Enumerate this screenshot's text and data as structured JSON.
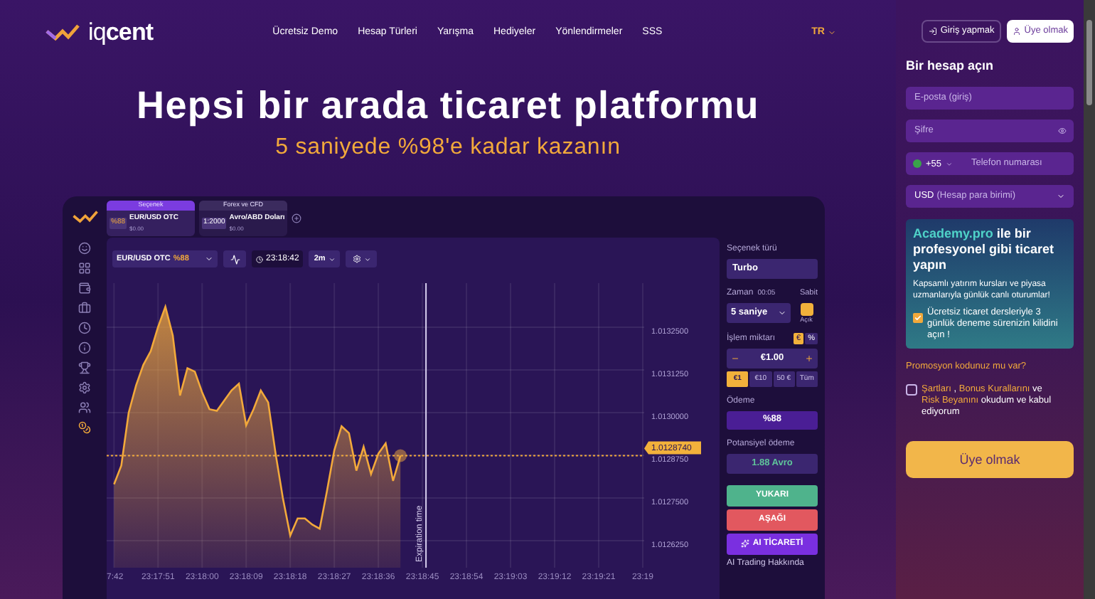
{
  "logo": "iq**cent**",
  "nav": {
    "links": [
      "Ücretsiz Demo",
      "Hesap Türleri",
      "Yarışma",
      "Hediyeler",
      "Yönlendirmeler",
      "SSS"
    ],
    "language": "TR"
  },
  "hero": {
    "title": "Hepsi bir arada ticaret platformu",
    "subtitle": "5 saniyede %98'e kadar kazanın"
  },
  "platform": {
    "sidebar_icons": [
      {
        "selected": false
      },
      {
        "selected": false
      },
      {
        "selected": false
      },
      {
        "selected": false
      },
      {
        "selected": false
      },
      {
        "selected": false
      },
      {
        "selected": false
      },
      {
        "selected": false
      },
      {
        "selected": false
      },
      {
        "selected": true
      }
    ],
    "tabs": [
      {
        "header": "Seçenek",
        "badge": "%88",
        "name": "EUR/USD OTC",
        "balance": "$0.00",
        "selected": true
      },
      {
        "header": "Forex ve CFD",
        "badge": "1:2000",
        "name": "Avro/ABD Doları",
        "balance": "$0.00",
        "selected": false
      }
    ],
    "toolbar": {
      "asset": "EUR/USD OTC",
      "payout": "%88",
      "time": "23:18:42",
      "interval": "2m"
    },
    "chart_data": {
      "type": "area",
      "categories": [
        "7:42",
        null,
        null,
        null,
        null,
        null,
        "23:17:51",
        null,
        null,
        null,
        null,
        null,
        "23:18:00",
        null,
        null,
        null,
        null,
        null,
        "23:18:09",
        null,
        null,
        null,
        null,
        null,
        "23:18:18",
        null,
        null,
        null,
        null,
        null,
        "23:18:27",
        null,
        null,
        null,
        null,
        null,
        "23:18:36",
        null,
        null,
        null,
        null,
        null,
        "23:18:45",
        null,
        null,
        null,
        null,
        null,
        "23:18:54",
        null,
        null,
        null,
        null,
        null,
        "23:19:03",
        null,
        null,
        null,
        null,
        null,
        "23:19:12",
        null,
        null,
        null,
        null,
        null,
        "23:19:21",
        null,
        null,
        null,
        null,
        null,
        "23:19"
      ],
      "series": [
        {
          "color": "#f2a93b",
          "values": [
            1.01279,
            1.012845,
            1.013,
            1.01308,
            1.01314,
            1.01318,
            1.01325,
            1.01331,
            1.013226,
            1.01305,
            1.01313,
            1.01312,
            1.01306,
            1.01301,
            1.013005,
            1.013035,
            1.013065,
            1.013085,
            1.012963,
            1.01301,
            1.013065,
            1.01303,
            1.01288,
            1.01275,
            1.01264,
            1.01269,
            1.01269,
            1.012672,
            1.01266,
            1.01277,
            1.01289,
            1.01296,
            1.01294,
            1.01283,
            1.0129,
            1.01282,
            1.01288,
            1.01291,
            1.0128,
            1.012874,
            null,
            null,
            null,
            null,
            null,
            null,
            null,
            null,
            null,
            null,
            null,
            null,
            null,
            null,
            null,
            null,
            null,
            null,
            null,
            null,
            null,
            null,
            null,
            null,
            null,
            null,
            null,
            null,
            null,
            null,
            null,
            null,
            null
          ]
        }
      ],
      "ylim": [
        1.012546,
        1.013379
      ],
      "grid": true,
      "ref_lines": [
        {
          "axis": "y",
          "value": 1.012874,
          "label": "1.0128740"
        }
      ],
      "yticks": [
        {
          "value": 1.01325,
          "label": "1.0132500"
        },
        {
          "value": 1.013125,
          "label": "1.0131250"
        },
        {
          "value": 1.013,
          "label": "1.0130000"
        },
        {
          "value": 1.012875,
          "label": "1.0128750"
        },
        {
          "value": 1.01275,
          "label": "1.0127500"
        },
        {
          "value": 1.012625,
          "label": "1.0126250"
        }
      ]
    },
    "expiration_label": "Expiration time",
    "trade": {
      "option_label": "Seçenek türü",
      "option": "Turbo",
      "time_label": "Zaman",
      "countdown": "00:05",
      "fixed_label": "Sabit",
      "duration": "5 saniye",
      "fixed_on": true,
      "fixed_state": "Açık",
      "amount_label": "İşlem miktarı",
      "units": [
        {
          "label": "€",
          "selected": true
        },
        {
          "label": "%",
          "selected": false
        }
      ],
      "amount": "€1.00",
      "quick": [
        {
          "label": "€1",
          "selected": true
        },
        {
          "label": "€10",
          "selected": false
        },
        {
          "label": "50 €",
          "selected": false
        },
        {
          "label": "Tüm",
          "selected": false
        }
      ],
      "payout_label": "Ödeme",
      "payout": "%88",
      "potential_label": "Potansiyel ödeme",
      "potential": "1.88 Avro",
      "up": "YUKARI",
      "down": "AŞAĞI",
      "ai": "AI TİCARETİ",
      "ai_info": "AI Trading Hakkında"
    }
  },
  "signup": {
    "login": "Giriş yapmak",
    "register": "Üye olmak",
    "heading": "Bir hesap açın",
    "email": {
      "placeholder": "E-posta (giriş)"
    },
    "password": {
      "placeholder": "Şifre"
    },
    "phone": {
      "code": "+55",
      "placeholder": "Telefon numarası"
    },
    "currency": {
      "value": "USD",
      "hint": "(Hesap para birimi)"
    },
    "academy": {
      "brand": "Academy.pro",
      "heading": "ile bir profesyonel gibi ticaret yapın",
      "text": "Kapsamlı yatırım kursları ve piyasa uzmanlarıyla günlük canlı oturumlar!",
      "checked": true,
      "offer": "Ücretsiz ticaret dersleriyle 3 günlük deneme sürenizin kilidini açın !"
    },
    "promo": "Promosyon kodunuz mu var?",
    "terms": {
      "checked": false,
      "parts": [
        {
          "kind": "link",
          "text": "Şartları"
        },
        {
          "kind": "text",
          "text": " , "
        },
        {
          "kind": "link",
          "text": "Bonus Kurallarını"
        },
        {
          "kind": "text",
          "text": " ve "
        },
        {
          "kind": "link",
          "text": "Risk Beyanını"
        },
        {
          "kind": "text",
          "text": " okudum ve kabul ediyorum"
        }
      ]
    },
    "submit": "Üye olmak"
  }
}
